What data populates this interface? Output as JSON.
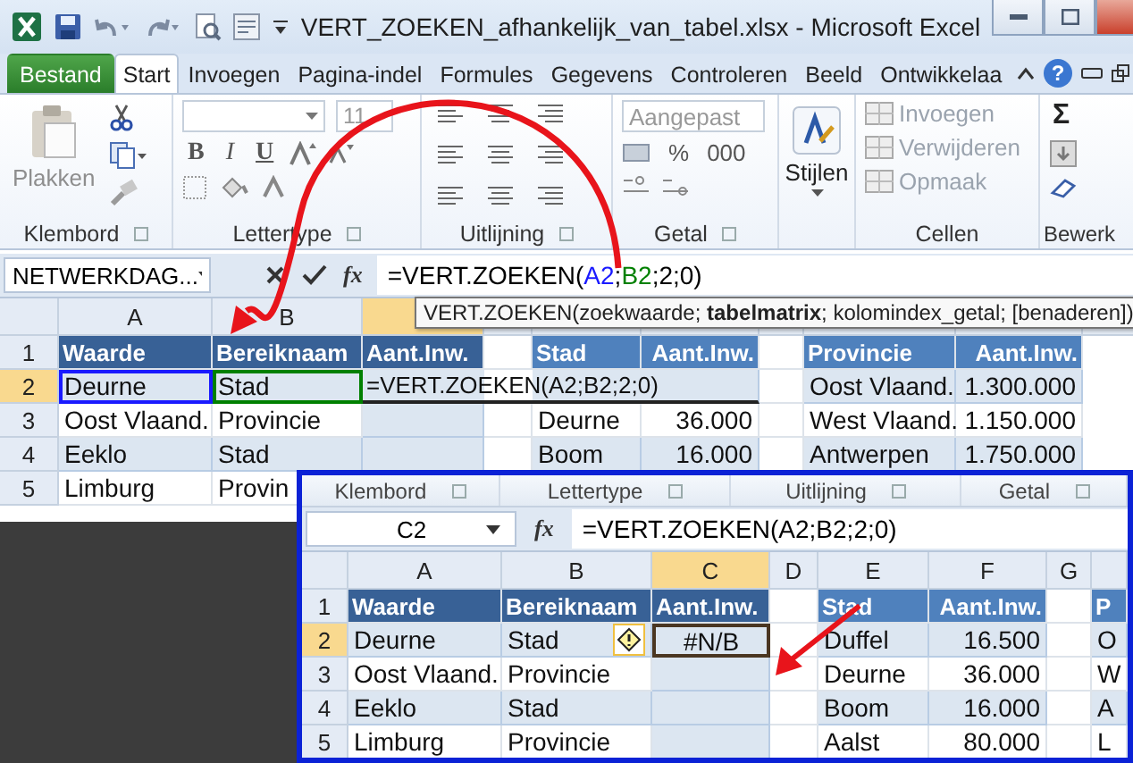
{
  "window": {
    "title": "VERT_ZOEKEN_afhankelijk_van_tabel.xlsx  -  Microsoft Excel"
  },
  "tabs": [
    {
      "label": "Bestand",
      "kind": "file",
      "selected": false
    },
    {
      "label": "Start",
      "kind": "tab",
      "selected": true
    },
    {
      "label": "Invoegen",
      "kind": "tab",
      "selected": false
    },
    {
      "label": "Pagina-indel",
      "kind": "tab",
      "selected": false
    },
    {
      "label": "Formules",
      "kind": "tab",
      "selected": false
    },
    {
      "label": "Gegevens",
      "kind": "tab",
      "selected": false
    },
    {
      "label": "Controleren",
      "kind": "tab",
      "selected": false
    },
    {
      "label": "Beeld",
      "kind": "tab",
      "selected": false
    },
    {
      "label": "Ontwikkelaa",
      "kind": "tab",
      "selected": false
    }
  ],
  "help": "?",
  "ribbon": {
    "clipboard": {
      "label": "Klembord",
      "paste": {
        "label": "Plakken",
        "disabled": true
      }
    },
    "font": {
      "label": "Lettertype",
      "size": "11",
      "styles": [
        "B",
        "I",
        "U"
      ]
    },
    "alignment": {
      "label": "Uitlijning"
    },
    "number": {
      "label": "Getal",
      "format": "Aangepast",
      "percent": "%",
      "thousands": "000"
    },
    "styles": {
      "label": "Stijlen"
    },
    "cells": {
      "label": "Cellen",
      "buttons": [
        {
          "label": "Invoegen",
          "disabled": true
        },
        {
          "label": "Verwijderen",
          "disabled": true
        },
        {
          "label": "Opmaak",
          "disabled": true
        }
      ]
    },
    "editing": {
      "label": "Bewerk",
      "sum": "Σ"
    }
  },
  "formula_bar": {
    "name_box": "NETWERKDAG...",
    "function_label": "fx",
    "formula": [
      {
        "text": "=VERT.ZOEKEN("
      },
      {
        "text": "A2",
        "color": "#1a1aff"
      },
      {
        "text": ";"
      },
      {
        "text": "B2",
        "color": "#008000"
      },
      {
        "text": ";2;0)"
      }
    ]
  },
  "tooltip": "VERT.ZOEKEN(zoekwaarde; **tabelmatrix**; kolomindex_getal; [benaderen])",
  "sheet": {
    "columns": [
      {
        "label": "A",
        "selected": false
      },
      {
        "label": "B",
        "selected": false
      },
      {
        "selected": true
      }
    ],
    "rows": [
      {
        "num": "1",
        "selected": false,
        "cells": [
          "Waarde",
          "Bereiknaam",
          "Aant.Inw.",
          null,
          "Stad",
          "Aant.Inw.",
          null,
          "Provincie",
          "Aant.Inw."
        ]
      },
      {
        "num": "2",
        "selected": true,
        "cells": [
          {
            "text": "Deurne",
            "color": "#1a1aff"
          },
          {
            "text": "Stad",
            "color": "#008000"
          },
          {
            "text": "=VERT.ZOEKEN(A2;B2;2;0)",
            "kind": "editing"
          },
          null,
          null,
          null,
          null,
          "Oost Vlaand.",
          "1.300.000"
        ]
      },
      {
        "num": "3",
        "selected": false,
        "cells": [
          "Oost Vlaand.",
          "Provincie",
          null,
          null,
          "Deurne",
          "36.000",
          null,
          "West Vlaand.",
          "1.150.000"
        ]
      },
      {
        "num": "4",
        "selected": false,
        "cells": [
          "Eeklo",
          "Stad",
          null,
          null,
          "Boom",
          "16.000",
          null,
          "Antwerpen",
          "1.750.000"
        ]
      },
      {
        "num": "5",
        "selected": false,
        "cells": [
          "Limburg",
          "Provin"
        ]
      }
    ]
  },
  "inset": {
    "groups": [
      "Klembord",
      "Lettertype",
      "Uitlijning",
      "Getal"
    ],
    "name_box": "C2",
    "function_label": "fx",
    "formula": "=VERT.ZOEKEN(A2;B2;2;0)",
    "columns": [
      {
        "label": "A",
        "selected": false
      },
      {
        "label": "B",
        "selected": false
      },
      {
        "label": "C",
        "selected": true
      },
      {
        "label": "D",
        "selected": false
      },
      {
        "label": "E",
        "selected": false
      },
      {
        "label": "F",
        "selected": false
      },
      {
        "label": "G",
        "selected": false
      }
    ],
    "rows": [
      {
        "num": "1",
        "selected": false,
        "cells": [
          "Waarde",
          "Bereiknaam",
          "Aant.Inw.",
          null,
          "Stad",
          "Aant.Inw.",
          null,
          "P"
        ]
      },
      {
        "num": "2",
        "selected": true,
        "cells": [
          "Deurne",
          {
            "text": "Stad",
            "warning": true
          },
          {
            "text": "#N/B",
            "kind": "error"
          },
          null,
          "Duffel",
          "16.500",
          null,
          "O"
        ]
      },
      {
        "num": "3",
        "selected": false,
        "cells": [
          "Oost Vlaand.",
          "Provincie",
          null,
          null,
          "Deurne",
          "36.000",
          null,
          "W"
        ]
      },
      {
        "num": "4",
        "selected": false,
        "cells": [
          "Eeklo",
          "Stad",
          null,
          null,
          "Boom",
          "16.000",
          null,
          "A"
        ]
      },
      {
        "num": "5",
        "selected": false,
        "cells": [
          "Limburg",
          "Provincie",
          null,
          null,
          "Aalst",
          "80.000",
          null,
          "L"
        ]
      }
    ]
  }
}
